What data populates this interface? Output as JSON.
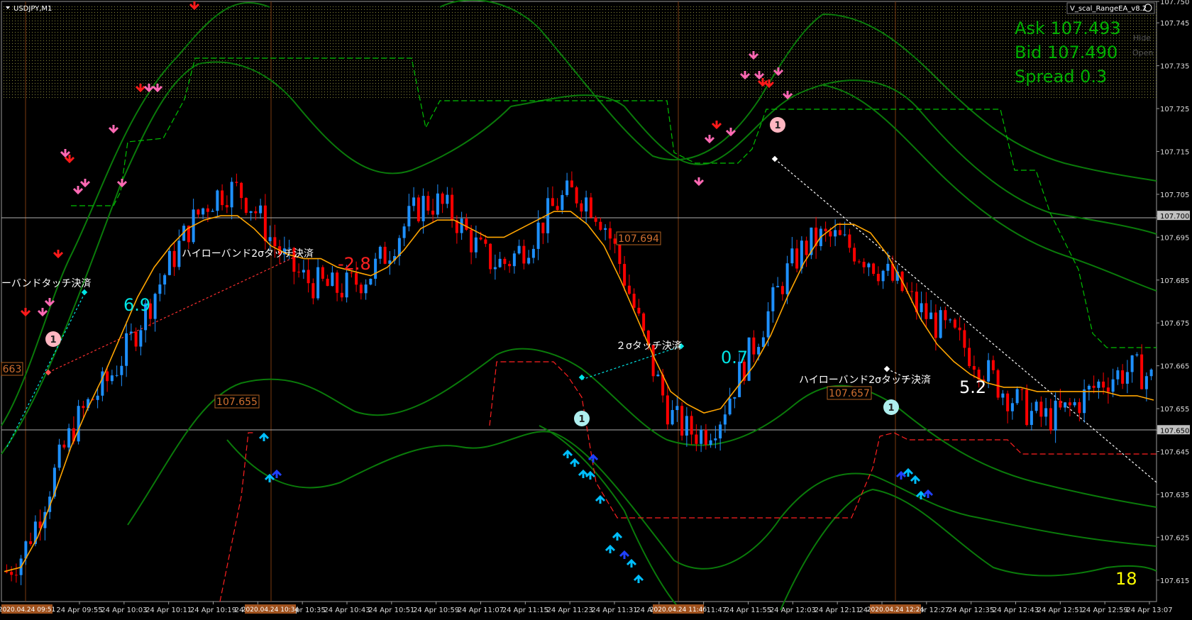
{
  "window": {
    "symbol_title": "USDJPY,M1",
    "ea_label": "V_scal_RangeEA_v8.2",
    "side_labels": [
      "Hide",
      "Open"
    ]
  },
  "quote": {
    "ask": "Ask 107.493",
    "bid": "Bid 107.490",
    "spread": "Spread 0.3"
  },
  "counter": "18",
  "colors": {
    "background": "#000000",
    "bull_candle": "#1e90ff",
    "bear_candle": "#ff0000",
    "bands": "#0a7a0a",
    "ma": "#ffa500",
    "resist_line": "#00c000",
    "support_line": "#ff2020",
    "signal_up": "#00bfff",
    "signal_down": "#ff69b4",
    "quote_text": "#00b000"
  },
  "chart_data": {
    "type": "candlestick",
    "ylim": [
      107.61,
      107.75
    ],
    "y_ticks": [
      "107.750",
      "107.745",
      "107.735",
      "107.725",
      "107.715",
      "107.705",
      "107.700",
      "107.695",
      "107.685",
      "107.675",
      "107.665",
      "107.655",
      "107.650",
      "107.645",
      "107.635",
      "107.625",
      "107.615"
    ],
    "highlighted_ticks": [
      "107.700",
      "107.650"
    ],
    "x_labels": [
      "24 Apr 09:55",
      "24 Apr 10:03",
      "24 Apr 10:11",
      "24 Apr 10:19",
      "24 Apr 10:27",
      "24 Apr 10:35",
      "24 Apr 10:43",
      "24 Apr 10:51",
      "24 Apr 10:59",
      "24 Apr 11:07",
      "24 Apr 11:15",
      "24 Apr 11:23",
      "24 Apr 11:31",
      "24 Apr 11:39",
      "24 Apr 11:47",
      "24 Apr 11:55",
      "24 Apr 12:03",
      "24 Apr 12:11",
      "24 Apr 12:19",
      "24 Apr 12:27",
      "24 Apr 12:35",
      "24 Apr 12:43",
      "24 Apr 12:51",
      "24 Apr 12:59",
      "24 Apr 13:07"
    ],
    "session_markers": [
      "2020.04.24 09:51",
      "2020.04.24 10:34",
      "2020.04.24 11:46",
      "2020.04.24 12:24"
    ],
    "price_boxes": [
      {
        "text": "107.655",
        "price": 107.655,
        "at": "10:28"
      },
      {
        "text": "107.694",
        "price": 107.694,
        "at": "11:43"
      },
      {
        "text": "107.657",
        "price": 107.657,
        "at": "12:23"
      },
      {
        "text": "663",
        "price": 107.663,
        "at": "09:48"
      }
    ],
    "annotations": [
      {
        "text": "ーバンドタッチ決済",
        "color": "#ffffff"
      },
      {
        "text": "ハイローバンド2σタッチ決済",
        "color": "#ffffff"
      },
      {
        "text": "２σタッチ決済",
        "color": "#ffffff"
      },
      {
        "text": "ハイローバンド2σタッチ決済",
        "color": "#ffffff"
      },
      {
        "text": "6.9",
        "color": "#00e5e5"
      },
      {
        "text": "-2.8",
        "color": "#ff0000"
      },
      {
        "text": "0.7",
        "color": "#00e5e5"
      },
      {
        "text": "5.2",
        "color": "#ffffff"
      }
    ],
    "entry_markers": [
      "1",
      "1",
      "1",
      "1"
    ],
    "ma_series": [
      107.617,
      107.618,
      107.625,
      107.635,
      107.646,
      107.655,
      107.663,
      107.672,
      107.681,
      107.688,
      107.693,
      107.697,
      107.699,
      107.7,
      107.7,
      107.697,
      107.693,
      107.691,
      107.69,
      107.69,
      107.688,
      107.687,
      107.686,
      107.688,
      107.692,
      107.697,
      107.699,
      107.699,
      107.697,
      107.695,
      107.695,
      107.697,
      107.699,
      107.701,
      107.701,
      107.698,
      107.693,
      107.685,
      107.676,
      107.667,
      107.659,
      107.656,
      107.654,
      107.655,
      107.66,
      107.665,
      107.672,
      107.681,
      107.689,
      107.695,
      107.698,
      107.698,
      107.696,
      107.691,
      107.684,
      107.676,
      107.67,
      107.666,
      107.663,
      107.661,
      107.66,
      107.66,
      107.659,
      107.659,
      107.659,
      107.659,
      107.659,
      107.658,
      107.658,
      107.657
    ]
  }
}
